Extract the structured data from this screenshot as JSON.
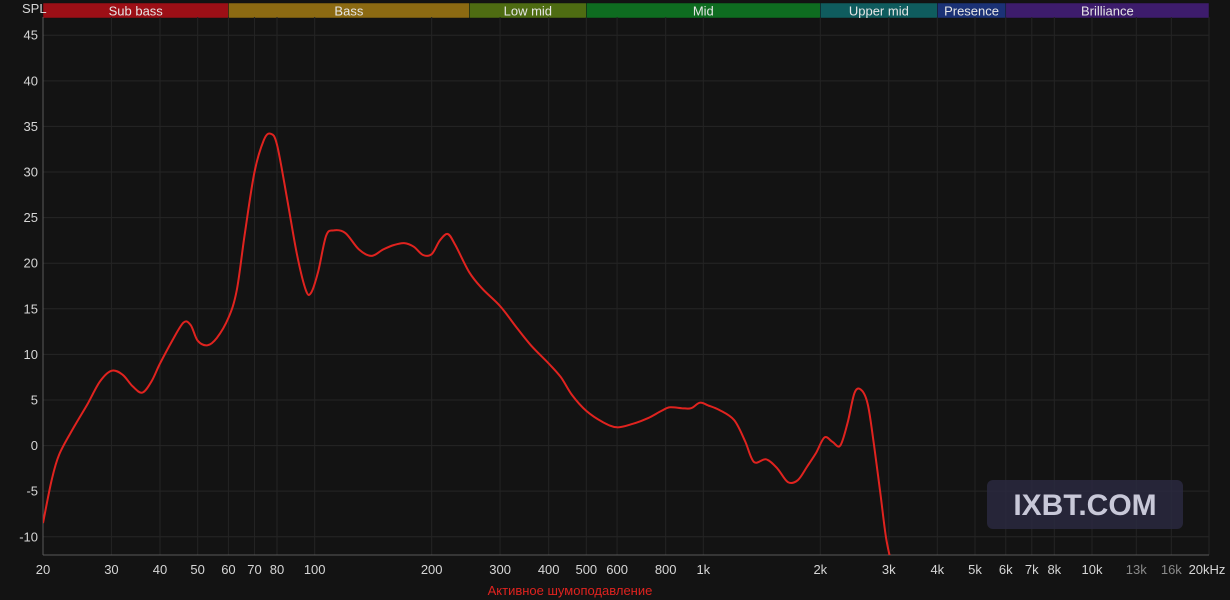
{
  "chart_data": {
    "type": "line",
    "ylabel": "SPL",
    "xlabel": "Активное шумоподавление",
    "x_scale": "log",
    "xlim": [
      20,
      20000
    ],
    "ylim": [
      -12,
      47
    ],
    "grid": true,
    "yticks": [
      {
        "value": 45,
        "label": "45"
      },
      {
        "value": 40,
        "label": "40"
      },
      {
        "value": 35,
        "label": "35"
      },
      {
        "value": 30,
        "label": "30"
      },
      {
        "value": 25,
        "label": "25"
      },
      {
        "value": 20,
        "label": "20"
      },
      {
        "value": 15,
        "label": "15"
      },
      {
        "value": 10,
        "label": "10"
      },
      {
        "value": 5,
        "label": "5"
      },
      {
        "value": 0,
        "label": "0"
      },
      {
        "value": -5,
        "label": "-5"
      },
      {
        "value": -10,
        "label": "-10"
      }
    ],
    "xticks": [
      {
        "value": 20,
        "label": "20"
      },
      {
        "value": 30,
        "label": "30"
      },
      {
        "value": 40,
        "label": "40"
      },
      {
        "value": 50,
        "label": "50"
      },
      {
        "value": 60,
        "label": "60"
      },
      {
        "value": 70,
        "label": "70"
      },
      {
        "value": 80,
        "label": "80"
      },
      {
        "value": 100,
        "label": "100"
      },
      {
        "value": 200,
        "label": "200"
      },
      {
        "value": 300,
        "label": "300"
      },
      {
        "value": 400,
        "label": "400"
      },
      {
        "value": 500,
        "label": "500"
      },
      {
        "value": 600,
        "label": "600"
      },
      {
        "value": 800,
        "label": "800"
      },
      {
        "value": 1000,
        "label": "1k"
      },
      {
        "value": 2000,
        "label": "2k"
      },
      {
        "value": 3000,
        "label": "3k"
      },
      {
        "value": 4000,
        "label": "4k"
      },
      {
        "value": 5000,
        "label": "5k"
      },
      {
        "value": 6000,
        "label": "6k"
      },
      {
        "value": 7000,
        "label": "7k"
      },
      {
        "value": 8000,
        "label": "8k"
      },
      {
        "value": 10000,
        "label": "10k"
      },
      {
        "value": 13000,
        "label": "13k",
        "dim": true
      },
      {
        "value": 16000,
        "label": "16k",
        "dim": true
      },
      {
        "value": 20000,
        "label": "20kHz"
      }
    ],
    "bands": [
      {
        "name": "Sub bass",
        "from": 20,
        "to": 60,
        "color": "#9c0f16"
      },
      {
        "name": "Bass",
        "from": 60,
        "to": 250,
        "color": "#8c6a12"
      },
      {
        "name": "Low mid",
        "from": 250,
        "to": 500,
        "color": "#4e6c12"
      },
      {
        "name": "Mid",
        "from": 500,
        "to": 2000,
        "color": "#0e6c20"
      },
      {
        "name": "Upper mid",
        "from": 2000,
        "to": 4000,
        "color": "#0f5c5e"
      },
      {
        "name": "Presence",
        "from": 4000,
        "to": 6000,
        "color": "#1b3276"
      },
      {
        "name": "Brilliance",
        "from": 6000,
        "to": 20000,
        "color": "#3d1c6c"
      }
    ],
    "series": [
      {
        "color": "#e0231f",
        "points": [
          [
            20,
            -8.5
          ],
          [
            21,
            -4
          ],
          [
            22,
            -1
          ],
          [
            24,
            2
          ],
          [
            26,
            4.5
          ],
          [
            28,
            7
          ],
          [
            30,
            8.2
          ],
          [
            32,
            7.8
          ],
          [
            34,
            6.5
          ],
          [
            36,
            5.8
          ],
          [
            38,
            7
          ],
          [
            40,
            9
          ],
          [
            43,
            11.5
          ],
          [
            46,
            13.5
          ],
          [
            48,
            13.2
          ],
          [
            50,
            11.5
          ],
          [
            53,
            11
          ],
          [
            56,
            11.8
          ],
          [
            60,
            14
          ],
          [
            63,
            17
          ],
          [
            66,
            23
          ],
          [
            70,
            30
          ],
          [
            74,
            33.5
          ],
          [
            77,
            34.2
          ],
          [
            80,
            33
          ],
          [
            85,
            27
          ],
          [
            90,
            21
          ],
          [
            95,
            17
          ],
          [
            98,
            16.8
          ],
          [
            102,
            19
          ],
          [
            107,
            23
          ],
          [
            112,
            23.6
          ],
          [
            120,
            23.3
          ],
          [
            130,
            21.5
          ],
          [
            140,
            20.8
          ],
          [
            150,
            21.5
          ],
          [
            160,
            22
          ],
          [
            170,
            22.2
          ],
          [
            180,
            21.8
          ],
          [
            190,
            20.9
          ],
          [
            200,
            21
          ],
          [
            210,
            22.5
          ],
          [
            220,
            23.2
          ],
          [
            230,
            22
          ],
          [
            250,
            19
          ],
          [
            270,
            17.2
          ],
          [
            300,
            15.3
          ],
          [
            330,
            13
          ],
          [
            360,
            11
          ],
          [
            400,
            9
          ],
          [
            430,
            7.5
          ],
          [
            460,
            5.5
          ],
          [
            500,
            3.8
          ],
          [
            550,
            2.6
          ],
          [
            600,
            2
          ],
          [
            660,
            2.4
          ],
          [
            720,
            3
          ],
          [
            780,
            3.8
          ],
          [
            820,
            4.2
          ],
          [
            880,
            4.1
          ],
          [
            930,
            4.1
          ],
          [
            980,
            4.7
          ],
          [
            1030,
            4.4
          ],
          [
            1100,
            3.9
          ],
          [
            1200,
            2.8
          ],
          [
            1280,
            0.5
          ],
          [
            1350,
            -1.8
          ],
          [
            1450,
            -1.5
          ],
          [
            1550,
            -2.5
          ],
          [
            1650,
            -4
          ],
          [
            1750,
            -3.8
          ],
          [
            1850,
            -2.3
          ],
          [
            1950,
            -0.8
          ],
          [
            2050,
            0.9
          ],
          [
            2150,
            0.4
          ],
          [
            2250,
            0
          ],
          [
            2350,
            2.5
          ],
          [
            2450,
            5.8
          ],
          [
            2550,
            6.1
          ],
          [
            2650,
            4.5
          ],
          [
            2750,
            0
          ],
          [
            2850,
            -5
          ],
          [
            2950,
            -10
          ],
          [
            3050,
            -13
          ]
        ]
      }
    ]
  },
  "logo": {
    "text": "IXBT.COM"
  }
}
